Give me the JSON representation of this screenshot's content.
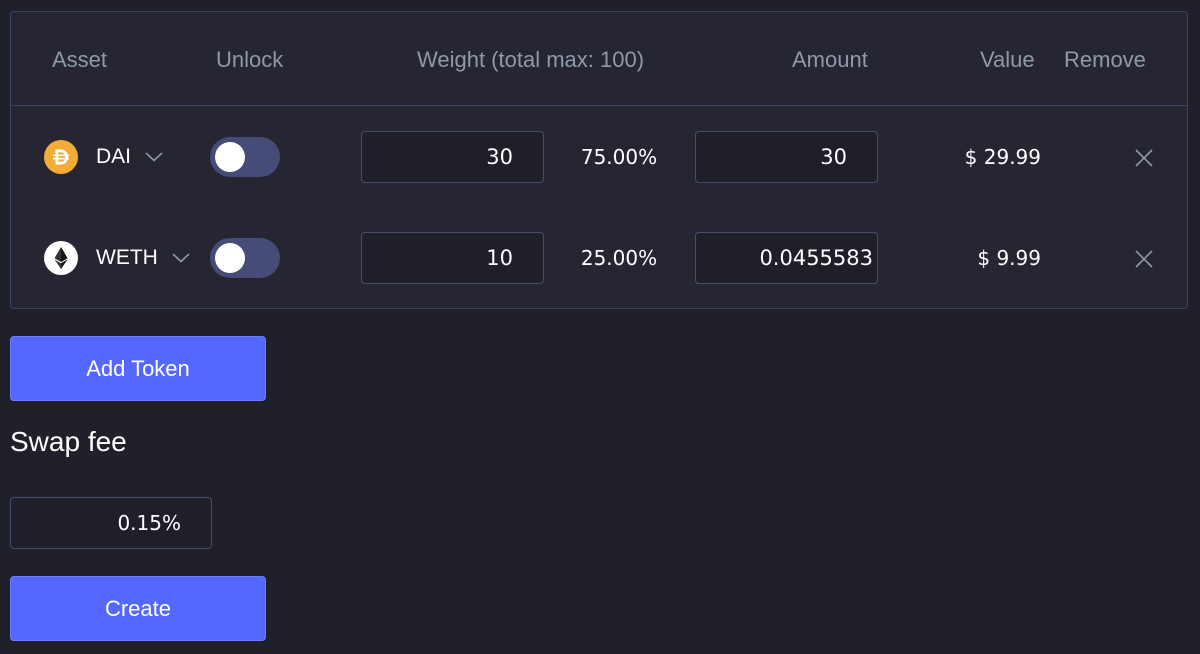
{
  "table": {
    "headers": {
      "asset": "Asset",
      "unlock": "Unlock",
      "weight": "Weight (total max: 100)",
      "amount": "Amount",
      "value": "Value",
      "remove": "Remove"
    },
    "rows": [
      {
        "symbol": "DAI",
        "icon": "dai-icon",
        "unlocked": false,
        "weight": "30",
        "weight_percent": "75.00%",
        "amount": "30",
        "value": "$ 29.99"
      },
      {
        "symbol": "WETH",
        "icon": "eth-icon",
        "unlocked": false,
        "weight": "10",
        "weight_percent": "25.00%",
        "amount": "0.0455583",
        "value": "$ 9.99"
      }
    ]
  },
  "actions": {
    "add_token_label": "Add Token",
    "create_label": "Create"
  },
  "swap_fee": {
    "title": "Swap fee",
    "value": "0.15",
    "suffix": "%"
  },
  "colors": {
    "background": "#20202a",
    "panel": "#262633",
    "border": "#3f3f68",
    "accent": "#5468ff",
    "muted_text": "#8e99aa",
    "dai": "#f5ac37"
  }
}
